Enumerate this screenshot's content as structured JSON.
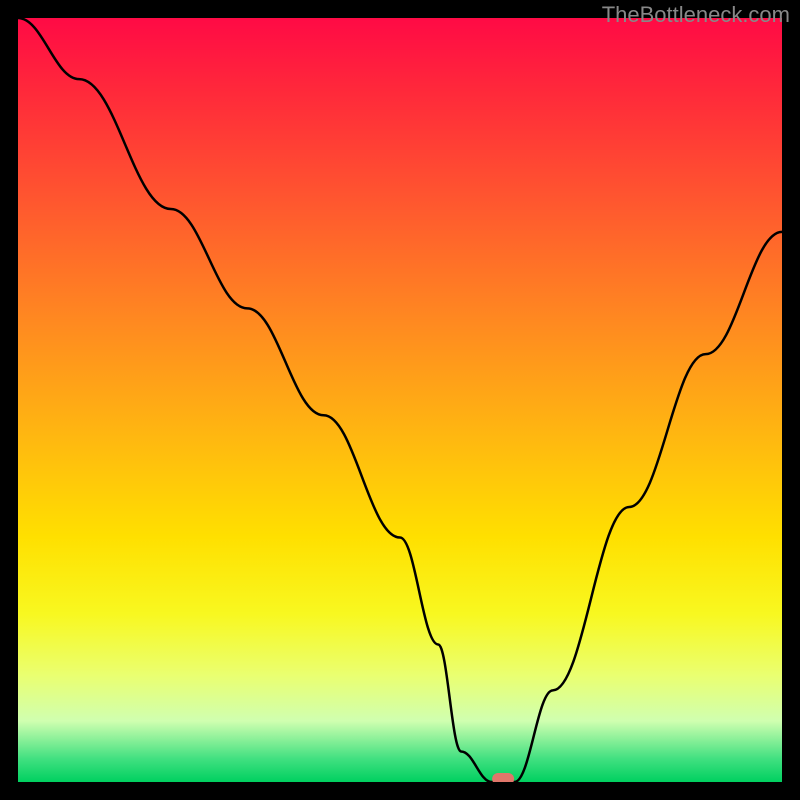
{
  "watermark": "TheBottleneck.com",
  "chart_data": {
    "type": "line",
    "title": "",
    "xlabel": "",
    "ylabel": "",
    "xlim": [
      0,
      100
    ],
    "ylim": [
      0,
      100
    ],
    "curve": {
      "description": "V-shaped bottleneck curve descending from top-left to a minimum then rising to right edge",
      "x": [
        0,
        8,
        20,
        30,
        40,
        50,
        55,
        58,
        62,
        65,
        70,
        80,
        90,
        100
      ],
      "y": [
        100,
        92,
        75,
        62,
        48,
        32,
        18,
        4,
        0,
        0,
        12,
        36,
        56,
        72
      ]
    },
    "gradient_stops": [
      {
        "pos": 0.0,
        "color": "#ff0a45"
      },
      {
        "pos": 0.1,
        "color": "#ff2a3a"
      },
      {
        "pos": 0.25,
        "color": "#ff5a2e"
      },
      {
        "pos": 0.4,
        "color": "#ff8a20"
      },
      {
        "pos": 0.55,
        "color": "#ffb810"
      },
      {
        "pos": 0.68,
        "color": "#ffe000"
      },
      {
        "pos": 0.78,
        "color": "#f8f820"
      },
      {
        "pos": 0.86,
        "color": "#eaff70"
      },
      {
        "pos": 0.92,
        "color": "#d0ffb0"
      },
      {
        "pos": 0.97,
        "color": "#40e080"
      },
      {
        "pos": 1.0,
        "color": "#00d060"
      }
    ],
    "marker": {
      "x": 63.5,
      "y": 0,
      "color": "#e0766a"
    }
  }
}
